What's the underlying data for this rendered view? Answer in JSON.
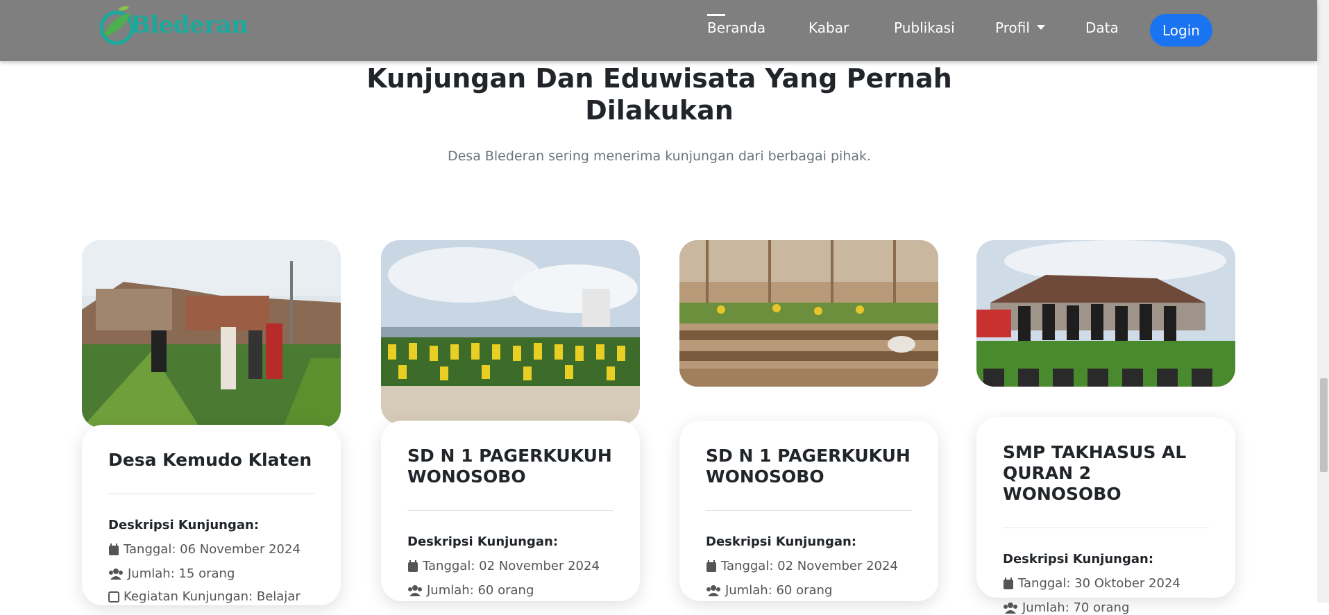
{
  "nav": {
    "logo_text": "Blederan",
    "items": [
      "Beranda",
      "Kabar",
      "Publikasi",
      "Profil",
      "Data"
    ],
    "login_label": "Login"
  },
  "section": {
    "title_line1": "Kunjungan Dan Eduwisata Yang Pernah",
    "title_line2": "Dilakukan",
    "subtitle": "Desa Blederan sering menerima kunjungan dari berbagai pihak."
  },
  "cards": [
    {
      "title_line1": "Desa Kemudo Klaten",
      "title_line2": "",
      "desc_label": "Deskripsi Kunjungan:",
      "tanggal": "Tanggal: 06 November 2024",
      "jumlah": "Jumlah: 15 orang",
      "extra": "Kegiatan Kunjungan: Belajar"
    },
    {
      "title_line1": "SD N 1 PAGERKUKUH",
      "title_line2": "WONOSOBO",
      "desc_label": "Deskripsi Kunjungan:",
      "tanggal": "Tanggal: 02 November 2024",
      "jumlah": "Jumlah: 60 orang"
    },
    {
      "title_line1": "SD N 1 PAGERKUKUH",
      "title_line2": "WONOSOBO",
      "desc_label": "Deskripsi Kunjungan:",
      "tanggal": "Tanggal: 02 November 2024",
      "jumlah": "Jumlah: 60 orang"
    },
    {
      "title_line1": "SMP TAKHASUS AL",
      "title_line2": "QURAN 2 WONOSOBO",
      "desc_label": "Deskripsi Kunjungan:",
      "tanggal": "Tanggal: 30 Oktober 2024",
      "jumlah": "Jumlah: 70 orang"
    }
  ],
  "colors": {
    "nav_bg": "#7f7f7f",
    "login_bg": "#1a73f0",
    "logo": "#1aa99b"
  },
  "icons": {
    "date": "calendar-icon",
    "count": "users-icon"
  }
}
